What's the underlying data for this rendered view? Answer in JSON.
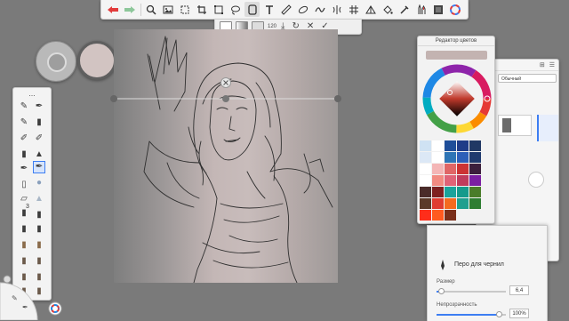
{
  "toolbar": {
    "tools": [
      "back-icon",
      "forward-icon",
      "zoom-icon",
      "image-icon",
      "crop-icon",
      "transform-icon",
      "selection-icon",
      "text-icon",
      "ruler-icon",
      "ellipse-icon",
      "curve-icon",
      "symmetry-icon",
      "grid-icon",
      "perspective-icon",
      "fill-icon",
      "brushes-icon",
      "layers-icon",
      "palette-icon"
    ]
  },
  "subtoolbar": {
    "size_label": "120"
  },
  "brush_palette": {
    "badge": "3"
  },
  "color_editor": {
    "title": "Редактор цветов",
    "current_color": "#c3b3b1",
    "swatches": [
      "#cfe2f3",
      "#ffffff",
      "#1f4e99",
      "#1f3c88",
      "#203864",
      "#dce8f6",
      "#ffffff",
      "#2e75b6",
      "#2d5fb8",
      "#1f3a6e",
      "#ffffff",
      "#f4b6b6",
      "#e06666",
      "#cc3333",
      "#3c1f3c",
      "#ffffff",
      "#f28b82",
      "#e06377",
      "#c03c5c",
      "#7b1fa2",
      "#4a2c2a",
      "#7f2020",
      "#1aa39b",
      "#159a8c",
      "#4a7c2a",
      "#5b3a29",
      "#e03c31",
      "#f46a1f",
      "#1f9f8f",
      "#2e7d32",
      "#ff2d1a",
      "#ff5a1f",
      "#7a2f1a",
      "",
      ""
    ]
  },
  "layer_panel": {
    "blend_mode": "Обычный"
  },
  "brush_props": {
    "brush_name": "Перо для чернил",
    "size_label": "Размер",
    "size_value": "6,4",
    "size_fraction": 0.07,
    "opacity_label": "Непрозрачность",
    "opacity_value": "100%",
    "opacity_fraction": 0.9
  }
}
